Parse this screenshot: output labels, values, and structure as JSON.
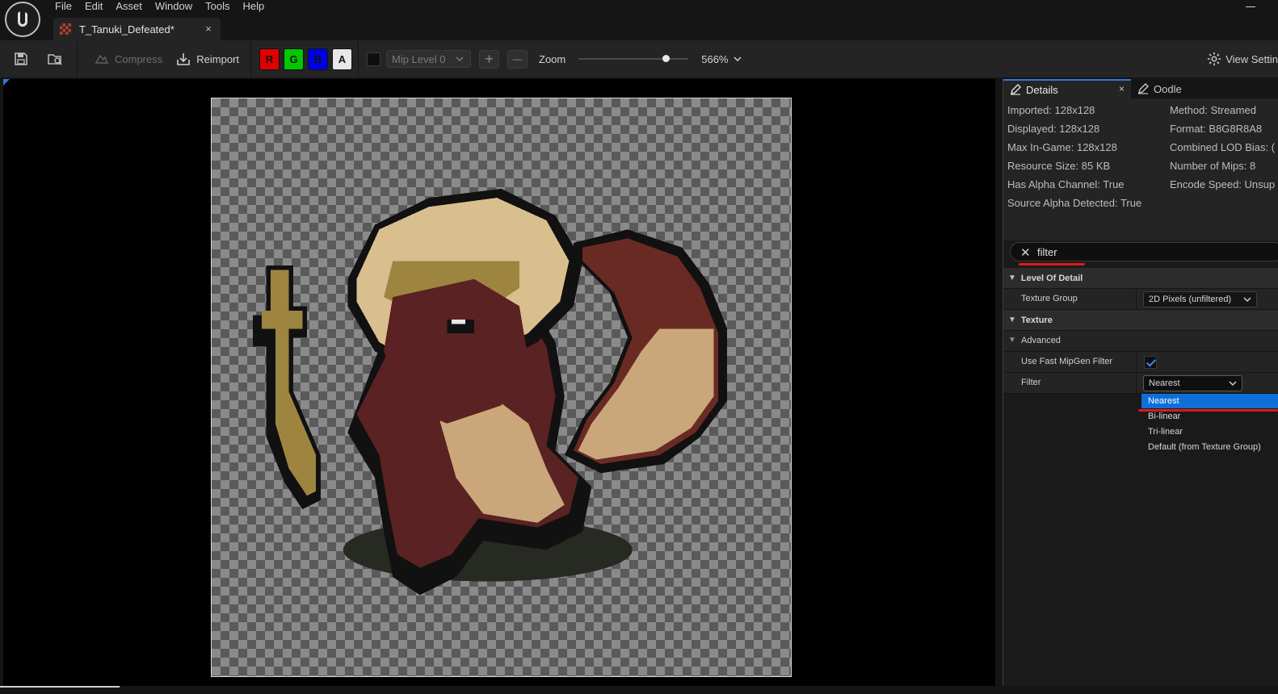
{
  "menu": [
    "File",
    "Edit",
    "Asset",
    "Window",
    "Tools",
    "Help"
  ],
  "asset_tab": {
    "label": "T_Tanuki_Defeated*",
    "close": "×"
  },
  "toolbar": {
    "compress_label": "Compress",
    "reimport_label": "Reimport",
    "channels": [
      "R",
      "G",
      "B",
      "A"
    ],
    "mip_level": "Mip Level 0",
    "plus": "+",
    "minus": "—",
    "zoom_label": "Zoom",
    "zoom_slider_fraction": 0.82,
    "zoom_value": "566%",
    "view_settings_label": "View Settin"
  },
  "panel": {
    "tab_details": "Details",
    "tab_details_close": "×",
    "tab_oodle": "Oodle"
  },
  "info": {
    "left": [
      "Imported: 128x128",
      "Displayed: 128x128",
      "Max In-Game: 128x128",
      "Resource Size: 85 KB",
      "Has Alpha Channel: True",
      "Source Alpha Detected: True"
    ],
    "right": [
      "Method: Streamed",
      "Format: B8G8R8A8",
      "Combined LOD Bias: (",
      "Number of Mips: 8",
      "Encode Speed: Unsup"
    ]
  },
  "search": {
    "value": "filter",
    "clear": "✕"
  },
  "properties": {
    "cat_lod": "Level Of Detail",
    "texture_group_label": "Texture Group",
    "texture_group_value": "2D Pixels (unfiltered)",
    "cat_texture": "Texture",
    "sub_advanced": "Advanced",
    "fast_mip_label": "Use Fast MipGen Filter",
    "fast_mip_checked": true,
    "filter_label": "Filter",
    "filter_value": "Nearest"
  },
  "filter_options": [
    "Nearest",
    "Bi-linear",
    "Tri-linear",
    "Default (from Texture Group)"
  ],
  "colors": {
    "accent": "#0e6fd8",
    "highlight_underline": "#e01818",
    "channel_r": "#e00000",
    "channel_g": "#00c800",
    "channel_b": "#0000e6",
    "channel_a": "#e8e8e8"
  }
}
